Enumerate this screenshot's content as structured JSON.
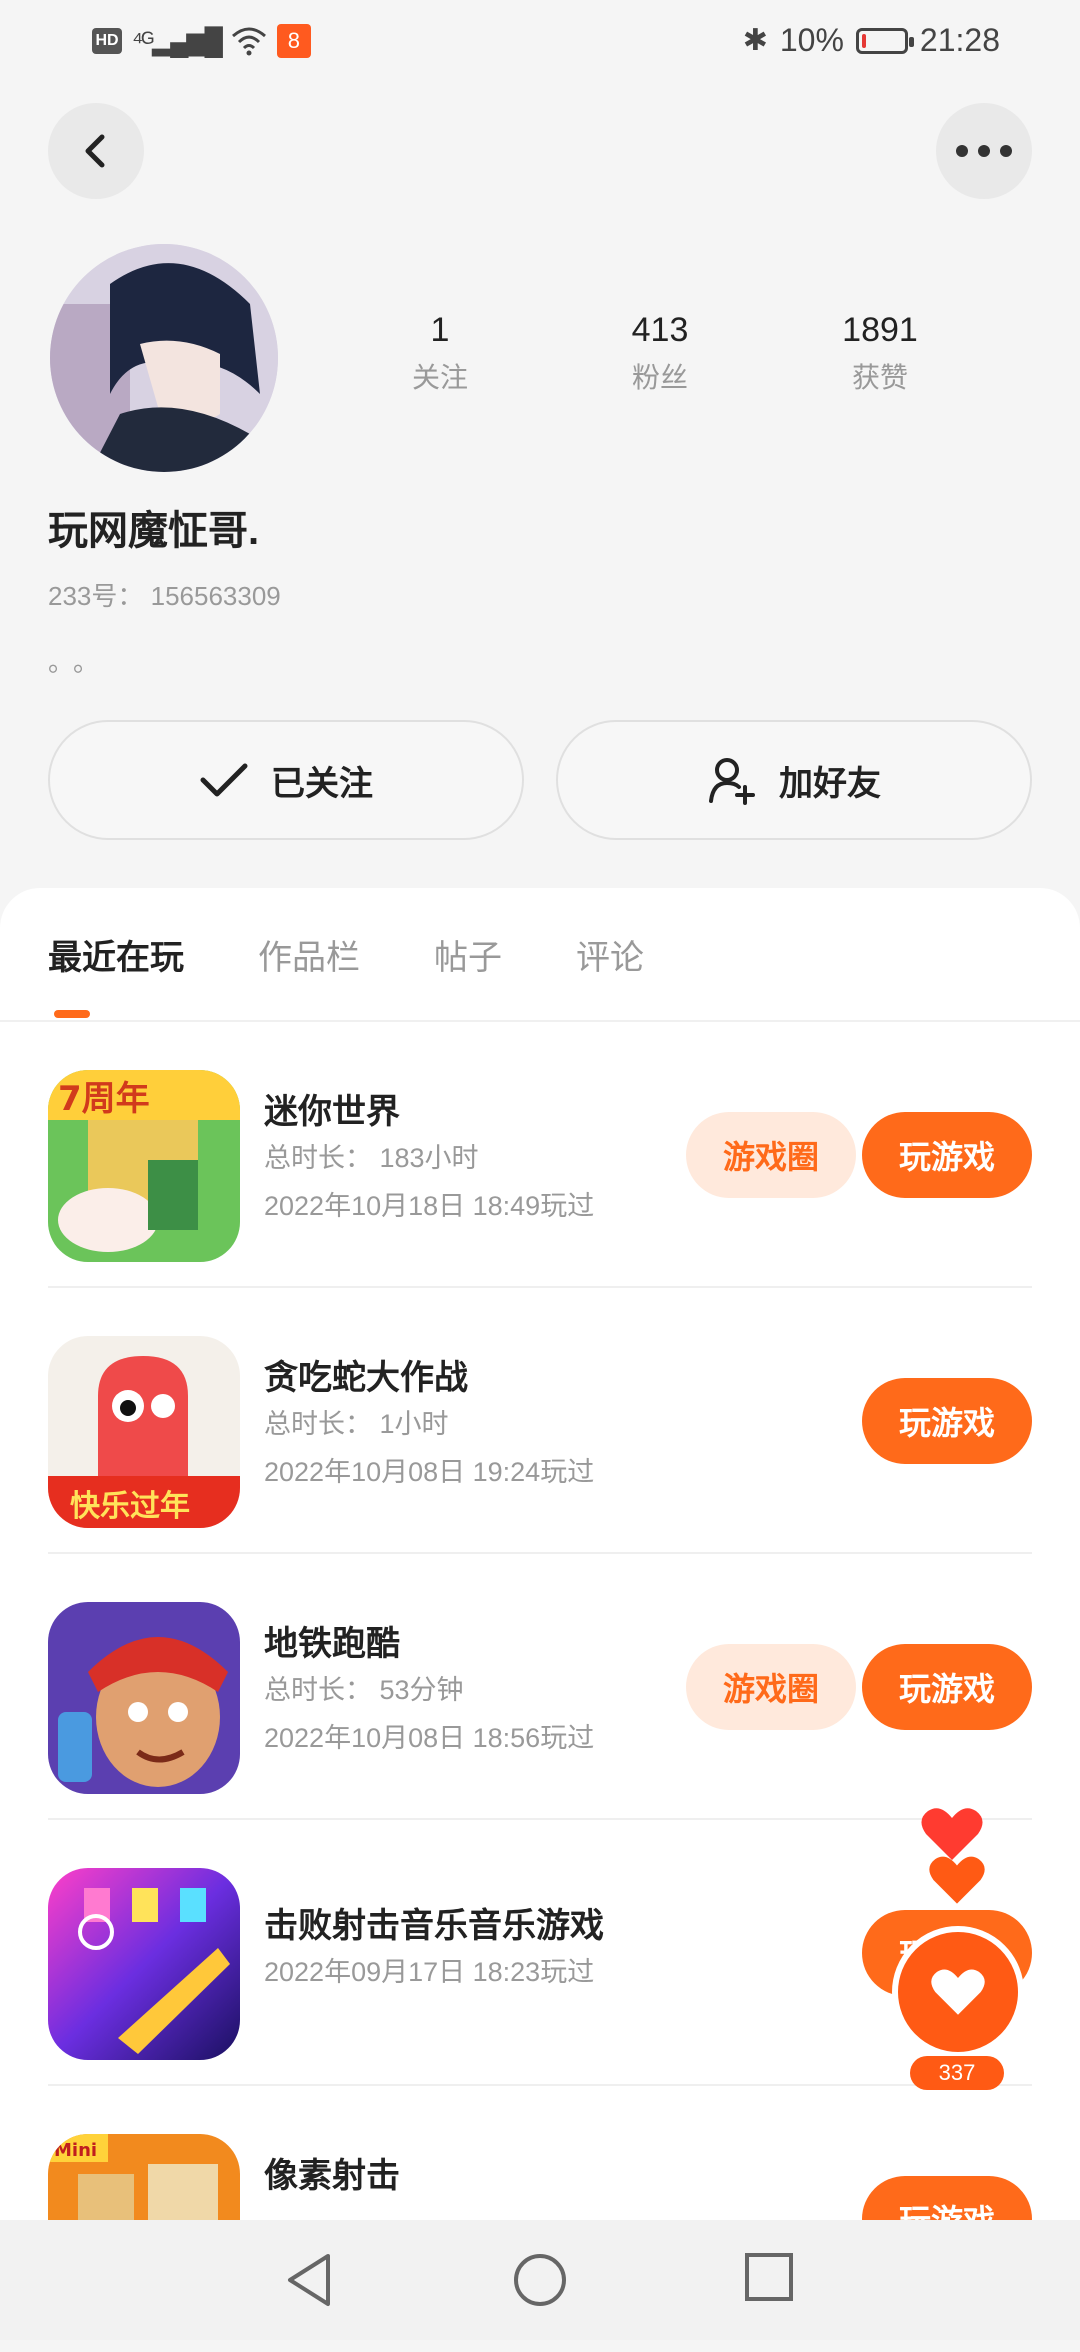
{
  "status_bar": {
    "hd": "HD",
    "signal": "⁴ᴳıll",
    "battery": "10%",
    "time": "21:28",
    "battery_level": 0.1
  },
  "profile": {
    "stats": [
      {
        "value": "1",
        "label": "关注"
      },
      {
        "value": "413",
        "label": "粉丝"
      },
      {
        "value": "1891",
        "label": "获赞"
      }
    ],
    "name": "玩网魔怔哥.",
    "id": "233号：  156563309",
    "bio": "。。"
  },
  "actions": {
    "follow_label": "已关注",
    "add_friend_label": "加好友"
  },
  "tabs": [
    "最近在玩",
    "作品栏",
    "帖子",
    "评论"
  ],
  "games": [
    {
      "title": "迷你世界",
      "duration": "总时长：  183小时",
      "played": "2022年10月18日  18:49玩过",
      "circle": "游戏圈",
      "play": "玩游戏"
    },
    {
      "title": "贪吃蛇大作战",
      "duration": "总时长：  1小时",
      "played": "2022年10月08日  19:24玩过",
      "circle": "",
      "play": "玩游戏"
    },
    {
      "title": "地铁跑酷",
      "duration": "总时长：  53分钟",
      "played": "2022年10月08日  18:56玩过",
      "circle": "游戏圈",
      "play": "玩游戏"
    },
    {
      "title": "击败射击音乐音乐游戏",
      "duration": "",
      "played": "2022年09月17日  18:23玩过",
      "circle": "",
      "play": "玩游戏"
    },
    {
      "title": "像素射击",
      "duration": "",
      "played": "",
      "circle": "",
      "play": "玩游戏"
    }
  ],
  "like": {
    "count": "337"
  },
  "colors": {
    "accent": "#ff6a1a",
    "accent_light": "#ffe9dc"
  }
}
